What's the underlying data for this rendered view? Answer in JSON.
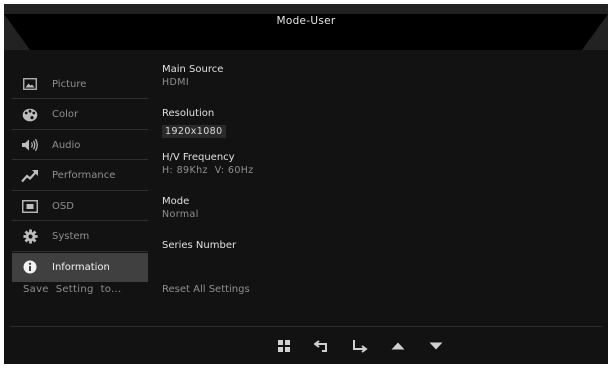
{
  "osd": {
    "title": "Mode-User",
    "menu": [
      {
        "label": "Picture",
        "icon": "picture-icon",
        "active": false
      },
      {
        "label": "Color",
        "icon": "palette-icon",
        "active": false
      },
      {
        "label": "Audio",
        "icon": "speaker-icon",
        "active": false
      },
      {
        "label": "Performance",
        "icon": "trend-up-icon",
        "active": false
      },
      {
        "label": "OSD",
        "icon": "osd-icon",
        "active": false
      },
      {
        "label": "System",
        "icon": "gear-icon",
        "active": false
      },
      {
        "label": "Information",
        "icon": "info-icon",
        "active": true
      }
    ],
    "save_setting": "Save  Setting  to...",
    "info": {
      "main_source": {
        "label": "Main Source",
        "value": "HDMI"
      },
      "resolution": {
        "label": "Resolution",
        "value": "1920x1080"
      },
      "frequency": {
        "label": "H/V Frequency",
        "value": "H: 89Khz  V: 60Hz"
      },
      "mode": {
        "label": "Mode",
        "value": "Normal"
      },
      "series_number": {
        "label": "Series Number",
        "value": ""
      }
    },
    "reset_all": "Reset All Settings",
    "nav_buttons": [
      "menu-grid-icon",
      "back-arrow-icon",
      "enter-arrow-icon",
      "up-triangle-icon",
      "down-triangle-icon"
    ],
    "colors": {
      "background": "#121212",
      "header": "#222222",
      "active_item": "#404040",
      "text_dim": "#8f8f8f",
      "text_bright": "#e6e6e6"
    }
  }
}
